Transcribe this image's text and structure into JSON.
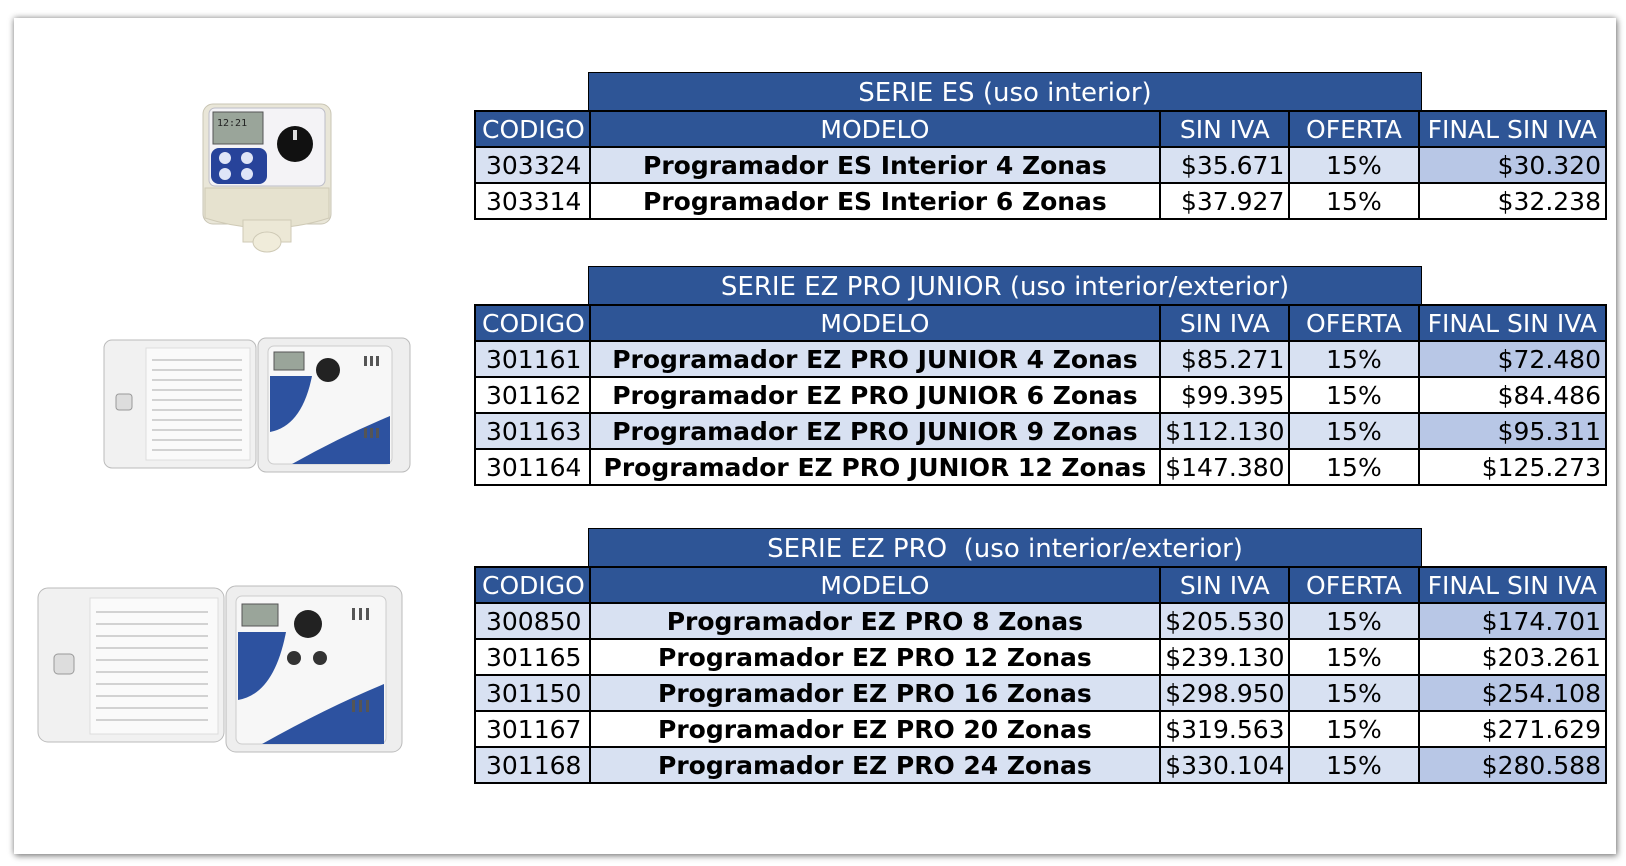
{
  "columns": {
    "code": "CODIGO",
    "model": "MODELO",
    "price": "SIN IVA",
    "offer": "OFERTA",
    "final": "FINAL SIN IVA"
  },
  "colors": {
    "header_bg": "#2e5596",
    "header_text": "#ffffff",
    "row_shade": "#d8e1f2",
    "final_shade": "#b8c7e6"
  },
  "sections": [
    {
      "title": "SERIE ES (uso interior)",
      "image": "indoor-controller-image",
      "rows": [
        {
          "code": "303324",
          "model": "Programador ES Interior 4 Zonas",
          "price": "$35.671",
          "offer": "15%",
          "final": "$30.320"
        },
        {
          "code": "303314",
          "model": "Programador ES Interior 6 Zonas",
          "price": "$37.927",
          "offer": "15%",
          "final": "$32.238"
        }
      ]
    },
    {
      "title": "SERIE EZ PRO JUNIOR (uso interior/exterior)",
      "image": "outdoor-controller-image",
      "rows": [
        {
          "code": "301161",
          "model": "Programador EZ PRO JUNIOR 4 Zonas",
          "price": "$85.271",
          "offer": "15%",
          "final": "$72.480"
        },
        {
          "code": "301162",
          "model": "Programador EZ PRO JUNIOR 6 Zonas",
          "price": "$99.395",
          "offer": "15%",
          "final": "$84.486"
        },
        {
          "code": "301163",
          "model": "Programador EZ PRO JUNIOR 9 Zonas",
          "price": "$112.130",
          "offer": "15%",
          "final": "$95.311"
        },
        {
          "code": "301164",
          "model": "Programador EZ PRO JUNIOR 12 Zonas",
          "price": "$147.380",
          "offer": "15%",
          "final": "$125.273"
        }
      ]
    },
    {
      "title": "SERIE EZ PRO  (uso interior/exterior)",
      "image": "outdoor-controller-image",
      "rows": [
        {
          "code": "300850",
          "model": "Programador EZ PRO 8 Zonas",
          "price": "$205.530",
          "offer": "15%",
          "final": "$174.701"
        },
        {
          "code": "301165",
          "model": "Programador EZ PRO 12 Zonas",
          "price": "$239.130",
          "offer": "15%",
          "final": "$203.261"
        },
        {
          "code": "301150",
          "model": "Programador EZ PRO 16 Zonas",
          "price": "$298.950",
          "offer": "15%",
          "final": "$254.108"
        },
        {
          "code": "301167",
          "model": "Programador EZ PRO 20 Zonas",
          "price": "$319.563",
          "offer": "15%",
          "final": "$271.629"
        },
        {
          "code": "301168",
          "model": "Programador EZ PRO 24 Zonas",
          "price": "$330.104",
          "offer": "15%",
          "final": "$280.588"
        }
      ]
    }
  ]
}
